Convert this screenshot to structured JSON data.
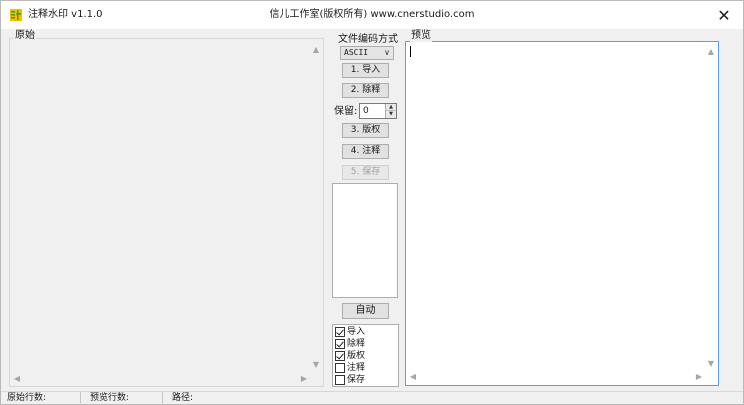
{
  "window": {
    "app_title": "注释水印 v1.1.0",
    "center_title": "信儿工作室(版权所有) www.cnerstudio.com",
    "close_glyph": "✕"
  },
  "left_panel": {
    "label": "原始"
  },
  "middle": {
    "encoding_label": "文件编码方式",
    "encoding_value": "ASCII",
    "buttons": {
      "import": "1. 导入",
      "remove": "2. 除释",
      "copyright": "3. 版权",
      "annotate": "4. 注释",
      "save": "5. 保存"
    },
    "keep_label": "保留:",
    "keep_value": "0",
    "auto_label": "自动",
    "checks": [
      {
        "label": "导入",
        "checked": true
      },
      {
        "label": "除释",
        "checked": true
      },
      {
        "label": "版权",
        "checked": true
      },
      {
        "label": "注释",
        "checked": false
      },
      {
        "label": "保存",
        "checked": false
      }
    ]
  },
  "right_panel": {
    "label": "预览"
  },
  "status": {
    "orig_lines": "原始行数:",
    "preview_lines": "预览行数:",
    "path": "路径:"
  },
  "icons": {
    "app": "app-icon",
    "close": "close-icon",
    "dropdown": "chevron-down-icon",
    "spin_up": "spin-up-icon",
    "spin_down": "spin-down-icon"
  },
  "colors": {
    "focus_border": "#5aa0e0",
    "window_bg": "#f0f0f0",
    "app_icon_green": "#3a9b2a",
    "app_icon_yellow": "#f2c200"
  }
}
